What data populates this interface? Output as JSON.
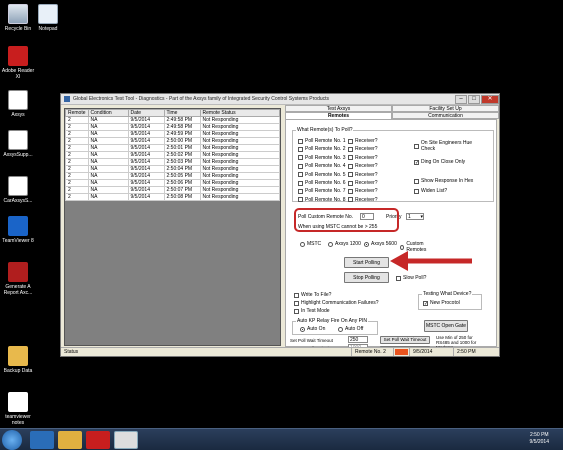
{
  "desktop": {
    "icons": [
      {
        "label": "Recycle Bin",
        "icon": "recycle-bin-icon"
      },
      {
        "label": "Notepad",
        "icon": "notepad-icon"
      },
      {
        "label": "Adobe Reader XI",
        "icon": "pdf-icon"
      },
      {
        "label": "Axsys",
        "icon": "axsys-icon"
      },
      {
        "label": "AxsysSupp...",
        "icon": "axsys-icon"
      },
      {
        "label": "CarAxsysS...",
        "icon": "axsys-icon"
      },
      {
        "label": "TeamViewer 8",
        "icon": "teamviewer-icon"
      },
      {
        "label": "Generate A Report Axc...",
        "icon": "report-icon"
      },
      {
        "label": "Backup Data",
        "icon": "folder-icon"
      },
      {
        "label": "teamviewer notes",
        "icon": "document-icon"
      }
    ]
  },
  "window": {
    "title": "Global Electronics Test Tool - Diagnostics - Part of the Axsys family of Integrated Security Control Systems Products"
  },
  "grid": {
    "columns": [
      "Remote",
      "Condition",
      "Date",
      "Time",
      "Remote Status"
    ],
    "rows": [
      [
        "2",
        "NA",
        "9/5/2014",
        "2:49:58 PM",
        "Not Responding"
      ],
      [
        "2",
        "NA",
        "9/5/2014",
        "2:49:58 PM",
        "Not Responding"
      ],
      [
        "2",
        "NA",
        "9/5/2014",
        "2:49:59 PM",
        "Not Responding"
      ],
      [
        "2",
        "NA",
        "9/5/2014",
        "2:50:00 PM",
        "Not Responding"
      ],
      [
        "2",
        "NA",
        "9/5/2014",
        "2:50:01 PM",
        "Not Responding"
      ],
      [
        "2",
        "NA",
        "9/5/2014",
        "2:50:02 PM",
        "Not Responding"
      ],
      [
        "2",
        "NA",
        "9/5/2014",
        "2:50:03 PM",
        "Not Responding"
      ],
      [
        "2",
        "NA",
        "9/5/2014",
        "2:50:04 PM",
        "Not Responding"
      ],
      [
        "2",
        "NA",
        "9/5/2014",
        "2:50:05 PM",
        "Not Responding"
      ],
      [
        "2",
        "NA",
        "9/5/2014",
        "2:50:06 PM",
        "Not Responding"
      ],
      [
        "2",
        "NA",
        "9/5/2014",
        "2:50:07 PM",
        "Not Responding"
      ],
      [
        "2",
        "NA",
        "9/5/2014",
        "2:50:08 PM",
        "Not Responding"
      ]
    ]
  },
  "tabs": {
    "top": [
      "Test Axsys",
      "Facility Set Up"
    ],
    "bottom": [
      "Remotes",
      "Communication"
    ]
  },
  "remotes": {
    "group_label": "What Remote(s) To Poll?",
    "poll_items": [
      "Poll Remote No. 1",
      "Poll Remote No. 2",
      "Poll Remote No. 3",
      "Poll Remote No. 4",
      "Poll Remote No. 5",
      "Poll Remote No. 6",
      "Poll Remote No. 7",
      "Poll Remote No. 8"
    ],
    "receiver_label": "Receiver?",
    "options": [
      {
        "label": "On Site Engineers Hue Check",
        "checked": false
      },
      {
        "label": "Ding On Close Only",
        "checked": true
      },
      {
        "label": "Show Response In Hex",
        "checked": false
      },
      {
        "label": "Widen List?",
        "checked": false
      }
    ],
    "custom_label": "Poll Custom Remote No.",
    "custom_value": "0",
    "priority_label": "Priority",
    "priority_value": "1",
    "note": "When using MSTC cannot be > 255",
    "protocols": [
      "MSTC",
      "Axsys 1200",
      "Axsys 5600",
      "Custom Remotes"
    ],
    "protocol_selected": 2,
    "start_button": "Start Polling",
    "stop_button": "Stop Polling",
    "slow_poll": "Slow Poll?",
    "write_to_file": "Write To File?",
    "highlight": "Highlight Communication Failures?",
    "test_mode": "In Test Mode",
    "testing_device_label": "Testing What Device?",
    "new_procotol": "New Procotol",
    "relay_label": "Auto KP Relay Fire On Any PIN",
    "auto_on": "Auto On",
    "auto_off": "Auto Off",
    "mstc_gate": "MSTC Open Gate",
    "set_poll_label": "Set Poll Wait Timeout",
    "set_poll_value": "250",
    "set_poll_button": "Set Poll Wait Timeout",
    "current_poll_label": "Current Poll Wait Timeout",
    "current_poll_value": "1000",
    "reset_poll_button": "Reset Poll Wait Timeout",
    "modem_note": "Use Min of 250 for RS485 and 1000 for Modems"
  },
  "statusbar": {
    "status": "Status",
    "remote": "Remote No. 2",
    "date": "9/5/2014",
    "time": "2:50 PM"
  },
  "taskbar": {
    "time": "2:50 PM",
    "date": "9/5/2014"
  },
  "colors": {
    "highlight": "#c62828",
    "status_indicator": "#e8531e"
  }
}
